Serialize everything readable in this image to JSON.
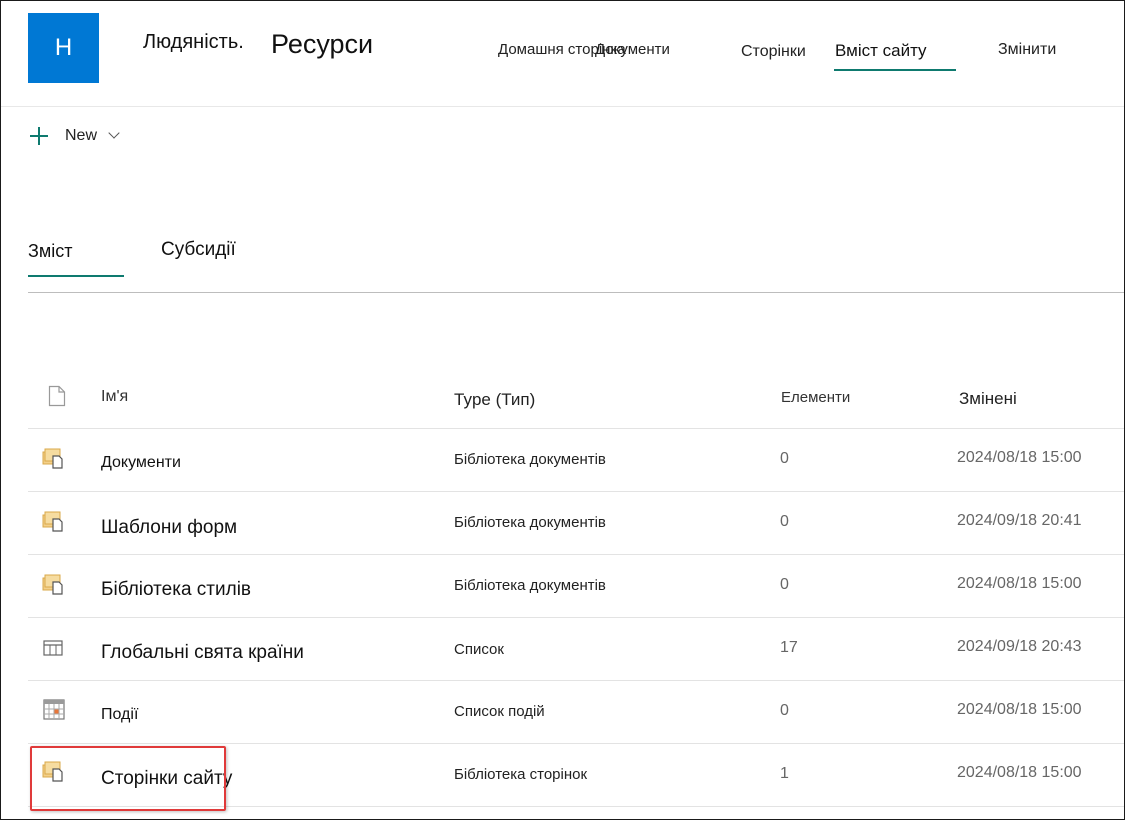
{
  "header": {
    "logo_letter": "H",
    "site_title": "Людяність.",
    "site_title_large": "Ресурси",
    "nav": {
      "home": "Домашня сторінка",
      "documents": "Документи",
      "pages": "Сторінки",
      "site_contents": "Вміст сайту",
      "edit": "Змінити"
    },
    "accent_color": "#0e7a6f",
    "logo_color": "#0078d4"
  },
  "command_bar": {
    "new_label": "New"
  },
  "tabs": {
    "contents": "Зміст",
    "subsites": "Субсидії"
  },
  "table": {
    "headers": {
      "name": "Ім'я",
      "type": "Type (Тип)",
      "items": "Елементи",
      "modified": "Змінені"
    },
    "rows": [
      {
        "icon": "library-icon",
        "name": "Документи",
        "type": "Бібліотека документів",
        "items": "0",
        "modified": "2024/08/18 15:00"
      },
      {
        "icon": "library-icon",
        "name": "Шаблони форм",
        "type": "Бібліотека документів",
        "items": "0",
        "modified": "2024/09/18 20:41"
      },
      {
        "icon": "library-icon",
        "name": "Бібліотека стилів",
        "type": "Бібліотека документів",
        "items": "0",
        "modified": "2024/08/18 15:00"
      },
      {
        "icon": "list-icon",
        "name": "Глобальні свята країни",
        "type": "Список",
        "items": "17",
        "modified": "2024/09/18 20:43"
      },
      {
        "icon": "calendar-icon",
        "name": "Події",
        "type": "Список подій",
        "items": "0",
        "modified": "2024/08/18 15:00"
      },
      {
        "icon": "library-icon",
        "name": "Сторінки сайту",
        "type": "Бібліотека сторінок",
        "items": "1",
        "modified": "2024/08/18 15:00"
      }
    ],
    "highlight_color": "#e03a3a"
  }
}
